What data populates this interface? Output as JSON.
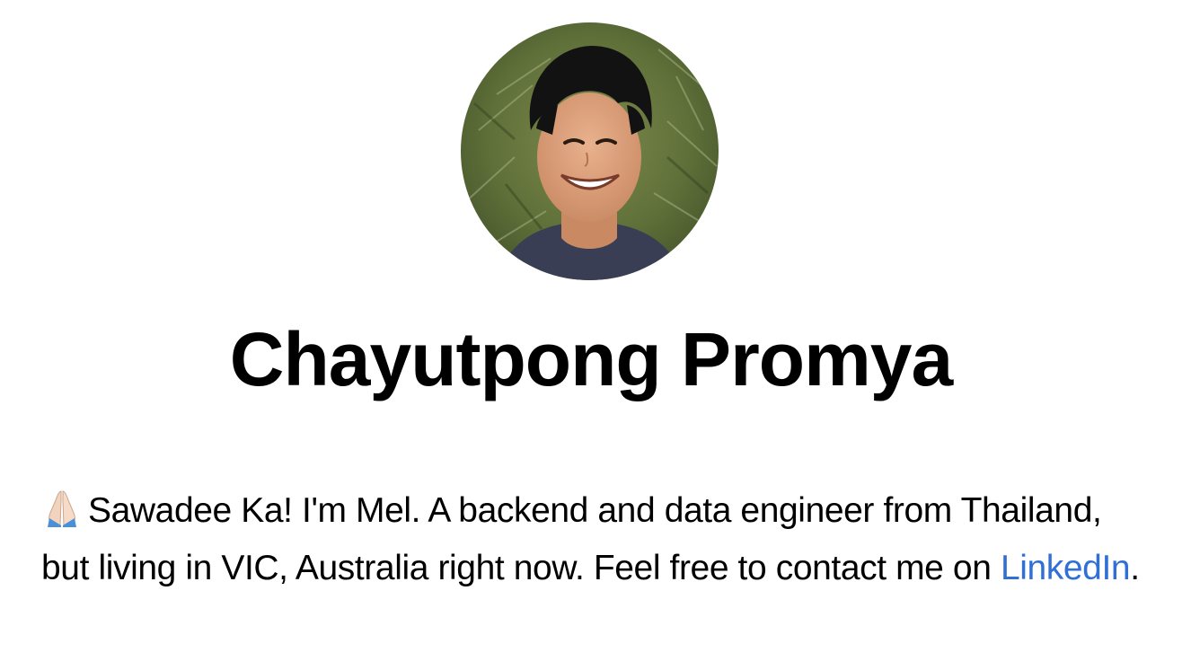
{
  "profile": {
    "name": "Chayutpong Promya",
    "avatar_icon": "profile-photo",
    "bio": {
      "emoji_icon": "folded-hands-emoji",
      "text_before_link": "Sawadee Ka! I'm Mel. A backend and data engineer from Thailand, but living in VIC, Australia right now. Feel free to contact me on ",
      "link_label": "LinkedIn",
      "text_after_link": "."
    }
  },
  "colors": {
    "link": "#2f6fd6",
    "text": "#000000",
    "background": "#ffffff"
  }
}
